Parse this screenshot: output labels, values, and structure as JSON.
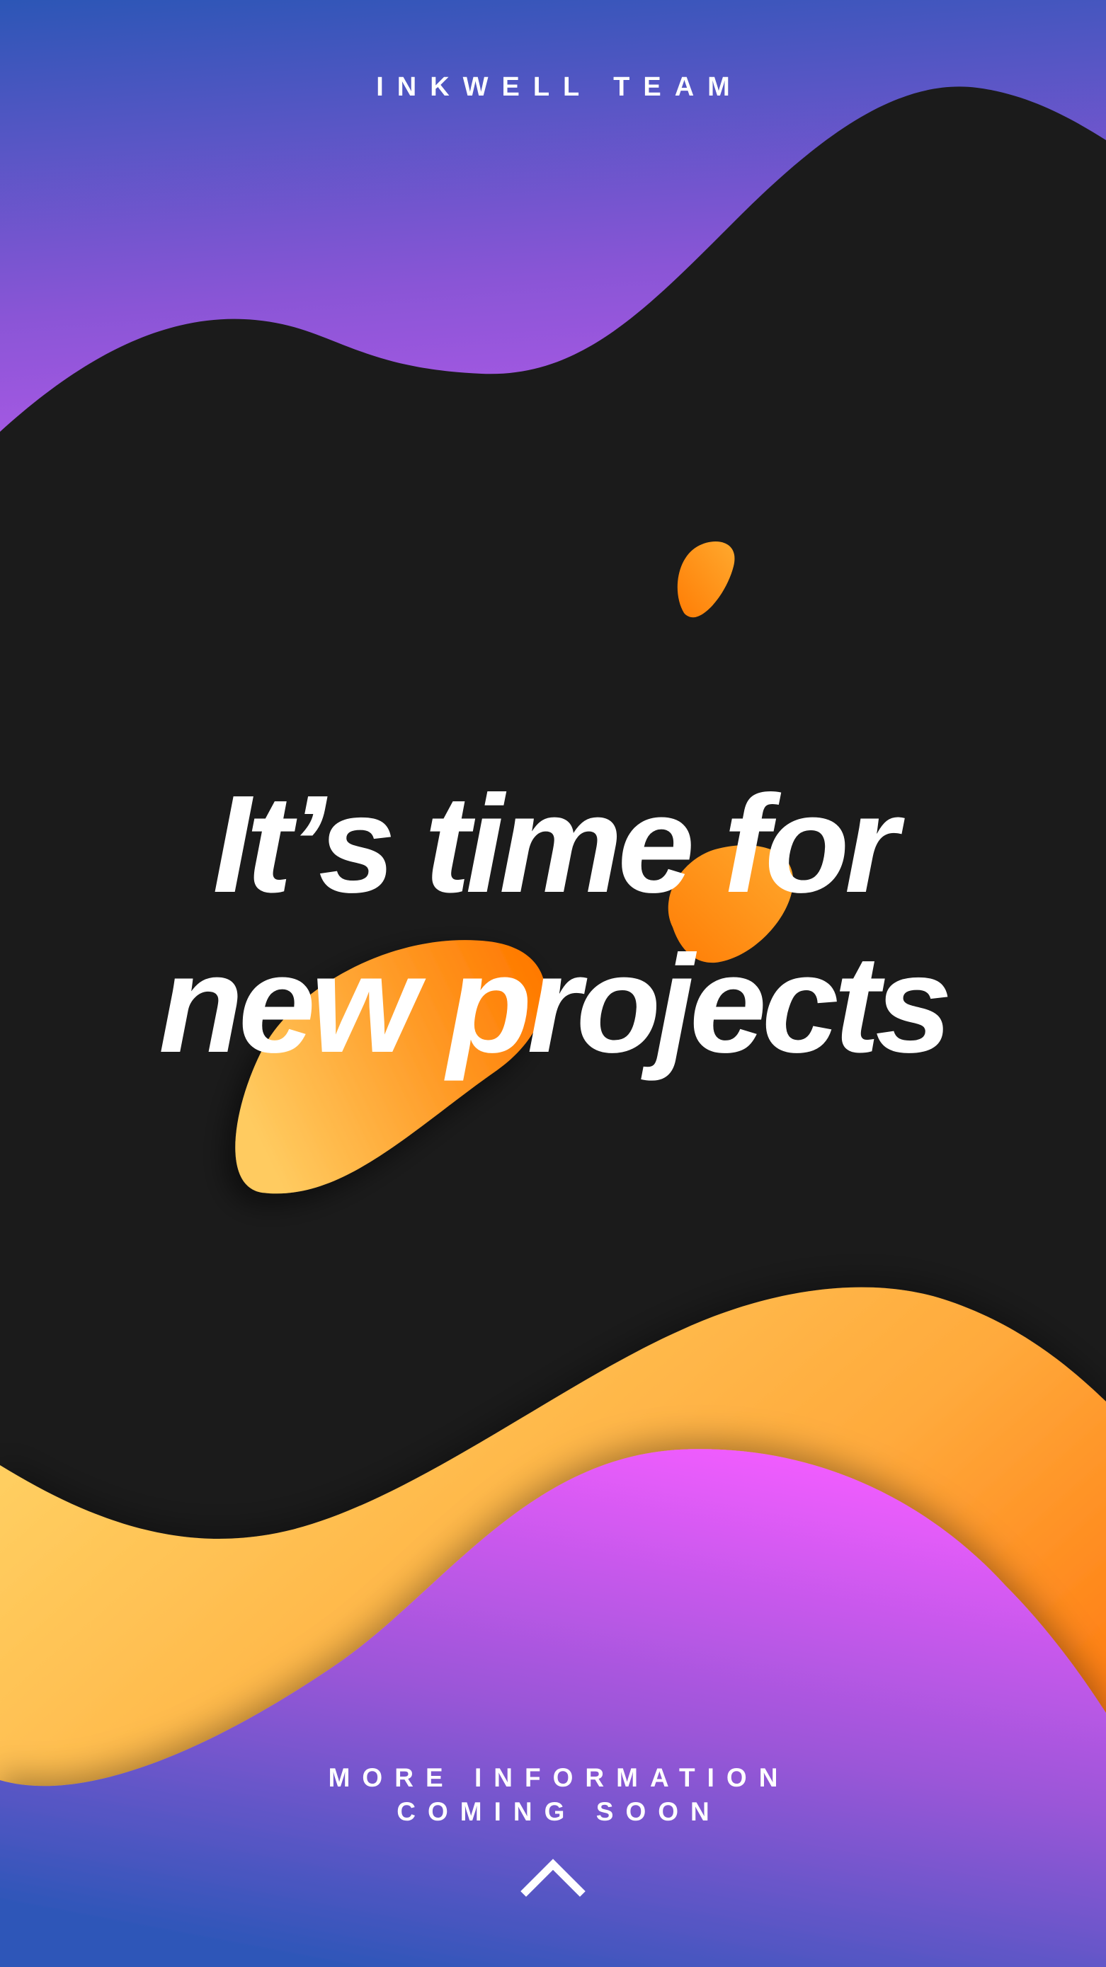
{
  "brand": {
    "name": "INKWELL TEAM"
  },
  "headline": {
    "line1": "It’s time for",
    "line2": "new projects"
  },
  "footer": {
    "line1": "MORE INFORMATION",
    "line2": "COMING SOON",
    "scroll_icon": "chevron-up-icon"
  },
  "colors": {
    "background_dark": "#1b1b1b",
    "blue": "#2a55b5",
    "violet": "#b35ae8",
    "magenta": "#f15bff",
    "orange_light": "#ffc85c",
    "orange_deep": "#ff7a00",
    "text": "#ffffff"
  }
}
